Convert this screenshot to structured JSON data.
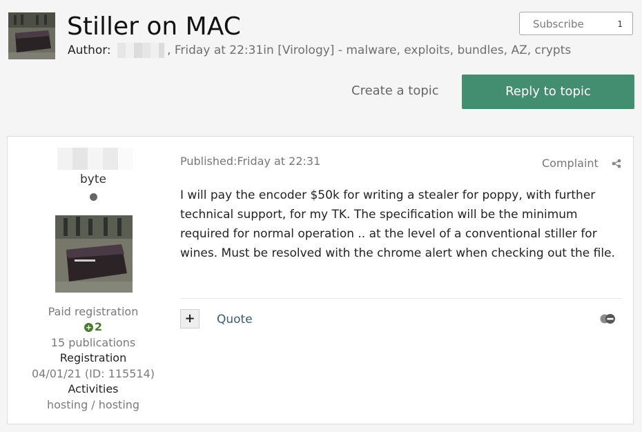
{
  "topic": {
    "title": "Stiller on MAC",
    "author_label": "Author:",
    "meta_rest": ", Friday at 22:31in [Virology] - malware, exploits, bundles, AZ, crypts"
  },
  "subscribe": {
    "label": "Subscribe",
    "count": "1"
  },
  "actions": {
    "create_topic": "Create a topic",
    "reply": "Reply to topic"
  },
  "post": {
    "author": {
      "rank": "byte",
      "group": "Paid registration",
      "reputation": "2",
      "publications": "15 publications",
      "registration_label": "Registration",
      "registration_value": "04/01/21 (ID: 115514)",
      "activities_label": "Activities",
      "activities_value": "hosting / hosting"
    },
    "published": "Published:Friday at 22:31",
    "complaint": "Complaint",
    "body": "I will pay the encoder $50k for writing a stealer for poppy, with further technical support, for my TK. The specification will be the minimum required for normal operation .. at the level of a conventional stiller for wines. Must be resolved with the chrome alert when checking out the file.",
    "quote": "Quote",
    "plus_symbol": "+"
  },
  "colors": {
    "reply_button": "#438e71",
    "page_bg": "#f5f5f5",
    "link": "#3a5a75"
  },
  "icons": [
    "share-icon",
    "moderation-icon",
    "online-status-dot"
  ]
}
